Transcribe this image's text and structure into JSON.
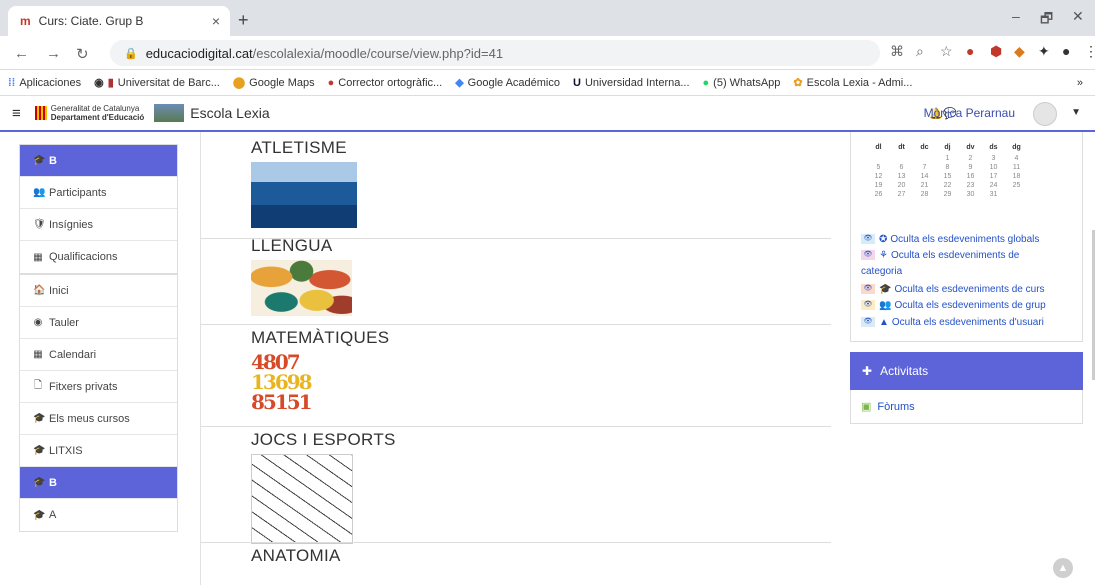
{
  "browser": {
    "tab_title": "Curs: Ciate. Grup B",
    "tab_close": "×",
    "new_tab": "+",
    "window_min": "–",
    "window_max": "🗗",
    "window_close": "✕",
    "url_host": "educaciodigital.cat",
    "url_path": "/escolalexia/moodle/course/view.php?id=41",
    "bookmarks": [
      "Aplicaciones",
      "Universitat de Barc...",
      "Google Maps",
      "Corrector ortogràfic...",
      "Google Académico",
      "Universidad Interna...",
      "(5) WhatsApp",
      "Escola Lexia - Admi..."
    ],
    "more_bookmarks": "»"
  },
  "header": {
    "gencat_line1": "Generalitat de Catalunya",
    "gencat_line2": "Departament d'Educació",
    "site_name": "Escola Lexia",
    "user_name": "Mònica Perarnau"
  },
  "sidebar": {
    "group1": [
      {
        "label": "B",
        "icon": "graduation-cap-icon",
        "glyph": "🎓",
        "active": true
      },
      {
        "label": "Participants",
        "icon": "users-icon",
        "glyph": "👥",
        "active": false
      },
      {
        "label": "Insígnies",
        "icon": "shield-icon",
        "glyph": "🛡",
        "active": false
      },
      {
        "label": "Qualificacions",
        "icon": "table-icon",
        "glyph": "▦",
        "active": false
      }
    ],
    "group2": [
      {
        "label": "Inici",
        "icon": "home-icon",
        "glyph": "🏠",
        "active": false
      },
      {
        "label": "Tauler",
        "icon": "dashboard-icon",
        "glyph": "◉",
        "active": false
      },
      {
        "label": "Calendari",
        "icon": "calendar-icon",
        "glyph": "▦",
        "active": false
      },
      {
        "label": "Fitxers privats",
        "icon": "file-icon",
        "glyph": "🗋",
        "active": false
      },
      {
        "label": "Els meus cursos",
        "icon": "graduation-cap-icon",
        "glyph": "🎓",
        "active": false
      },
      {
        "label": "LITXIS",
        "icon": "graduation-cap-icon",
        "glyph": "🎓",
        "active": false
      },
      {
        "label": "B",
        "icon": "graduation-cap-icon",
        "glyph": "🎓",
        "active": true
      },
      {
        "label": "A",
        "icon": "graduation-cap-icon",
        "glyph": "🎓",
        "active": false
      }
    ]
  },
  "sections": [
    {
      "title": "ATLETISME",
      "thumb": "running-track-image"
    },
    {
      "title": "LLENGUA",
      "thumb": "letters-collage-image"
    },
    {
      "title": "MATEMÀTIQUES",
      "thumb": "numbers-collage-image",
      "thumb_text": [
        "4807",
        "13698",
        "85151"
      ]
    },
    {
      "title": "JOCS I ESPORTS",
      "thumb": "hopscotch-drawing-image"
    },
    {
      "title": "ANATOMIA",
      "thumb": ""
    }
  ],
  "calendar": {
    "days": [
      "dl",
      "dt",
      "dc",
      "dj",
      "dv",
      "ds",
      "dg"
    ],
    "weeks": [
      [
        "",
        "",
        "",
        "1",
        "2",
        "3",
        "4"
      ],
      [
        "5",
        "6",
        "7",
        "8",
        "9",
        "10",
        "11"
      ],
      [
        "12",
        "13",
        "14",
        "15",
        "16",
        "17",
        "18"
      ],
      [
        "19",
        "20",
        "21",
        "22",
        "23",
        "24",
        "25"
      ],
      [
        "26",
        "27",
        "28",
        "29",
        "30",
        "31",
        ""
      ]
    ],
    "events": [
      {
        "label": "Oculta els esdeveniments globals",
        "color": "#d8ecf7",
        "glyph": "✪"
      },
      {
        "label": "Oculta els esdeveniments de",
        "color": "#f3d6ea",
        "glyph": "⚘"
      },
      {
        "label": "Oculta els esdeveniments de curs",
        "color": "#fbd9cc",
        "glyph": "🎓"
      },
      {
        "label": "Oculta els esdeveniments de grup",
        "color": "#fbecc4",
        "glyph": "👥"
      },
      {
        "label": "Oculta els esdeveniments d'usuari",
        "color": "#d9ecf5",
        "glyph": "▲"
      }
    ],
    "event2_cont": "categoria"
  },
  "activities": {
    "title": "Activitats",
    "items": [
      "Fòrums"
    ]
  },
  "colors": {
    "accent": "#5d63d9",
    "link": "#2451c7"
  }
}
